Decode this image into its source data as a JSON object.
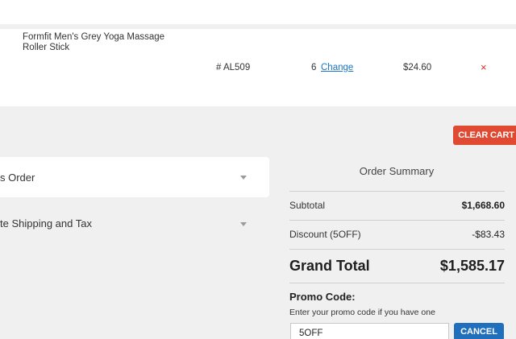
{
  "cart_item": {
    "name": "Formfit Men's Grey Yoga Massage Roller Stick",
    "sku": "# AL509",
    "quantity": "6",
    "change_label": "Change",
    "price": "$24.60",
    "remove_icon": "×"
  },
  "clear_cart_label": "CLEAR CART",
  "accordions": [
    {
      "label": "s Order"
    },
    {
      "label": "te Shipping and Tax"
    }
  ],
  "order_summary": {
    "title": "Order Summary",
    "subtotal_label": "Subtotal",
    "subtotal_value": "$1,668.60",
    "discount_label": "Discount (5OFF)",
    "discount_value": "-$83.43",
    "grand_total_label": "Grand Total",
    "grand_total_value": "$1,585.17"
  },
  "promo": {
    "title": "Promo Code:",
    "hint": "Enter your promo code if you have one",
    "value": "5OFF",
    "cancel_label": "CANCEL"
  },
  "colors": {
    "background": "#f0f0f0",
    "clear_cart": "#e04a33",
    "cancel_button": "#1f6fbd",
    "link": "#1a73c8",
    "remove": "#e32b2b"
  }
}
